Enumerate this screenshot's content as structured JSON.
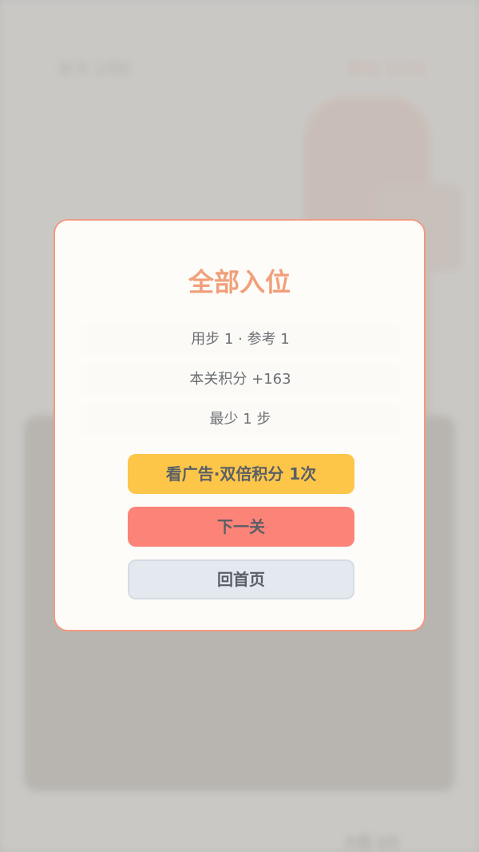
{
  "hud": {
    "level": "关卡 1/50",
    "score": "积分 2155",
    "placed_progress": "入位 1/1"
  },
  "modal": {
    "title": "全部入位",
    "steps_line": "用步 1 · 参考 1",
    "score_line": "本关积分 +163",
    "min_steps_line": "最少 1 步",
    "buttons": {
      "ad_double": "看广告·双倍积分 1次",
      "next": "下一关",
      "home": "回首页"
    }
  },
  "colors": {
    "title": "#f1a07a",
    "ad_button": "#fdc649",
    "next_button": "#fb8378",
    "home_button": "#e4e9f0",
    "modal_border": "#f29a83"
  }
}
